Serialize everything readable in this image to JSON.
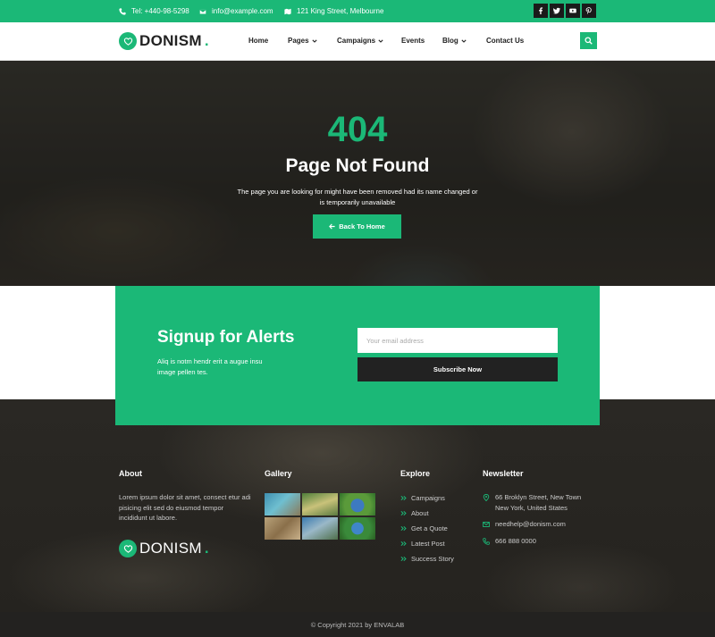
{
  "topbar": {
    "phone": "Tel: +440-98-5298",
    "email": "info@example.com",
    "address": "121 King Street, Melbourne",
    "social_icons": [
      "facebook-icon",
      "twitter-icon",
      "youtube-icon",
      "pinterest-icon"
    ]
  },
  "brand": {
    "name": "DONISM",
    "dot": ".",
    "accent_color": "#1bb877"
  },
  "nav": {
    "items": [
      {
        "label": "Home",
        "dropdown": false
      },
      {
        "label": "Pages",
        "dropdown": true
      },
      {
        "label": "Campaigns",
        "dropdown": true
      },
      {
        "label": "Events",
        "dropdown": false
      },
      {
        "label": "Blog",
        "dropdown": true
      },
      {
        "label": "Contact Us",
        "dropdown": false
      }
    ]
  },
  "hero": {
    "code": "404",
    "title": "Page Not Found",
    "message": "The page you are looking for might have been removed had its name changed or is temporarily unavailable",
    "button_label": "Back To Home"
  },
  "signup": {
    "title": "Signup for Alerts",
    "text": "Aliq is notm hendr erit a augue insu image pellen tes.",
    "email_placeholder": "Your email address",
    "button_label": "Subscribe Now"
  },
  "footer": {
    "about": {
      "heading": "About",
      "text": "Lorem ipsum dolor sit amet, consect etur adi pisicing elit sed do eiusmod tempor incididunt ut labore."
    },
    "gallery": {
      "heading": "Gallery"
    },
    "explore": {
      "heading": "Explore",
      "links": [
        "Campaigns",
        "About",
        "Get a Quote",
        "Latest Post",
        "Success Story"
      ]
    },
    "newsletter": {
      "heading": "Newsletter",
      "address_line1": "66 Broklyn Street, New Town",
      "address_line2": "New York, United States",
      "email": "needhelp@donism.com",
      "phone": "666 888 0000"
    },
    "copyright": "© Copyright 2021 by ENVALAB"
  }
}
